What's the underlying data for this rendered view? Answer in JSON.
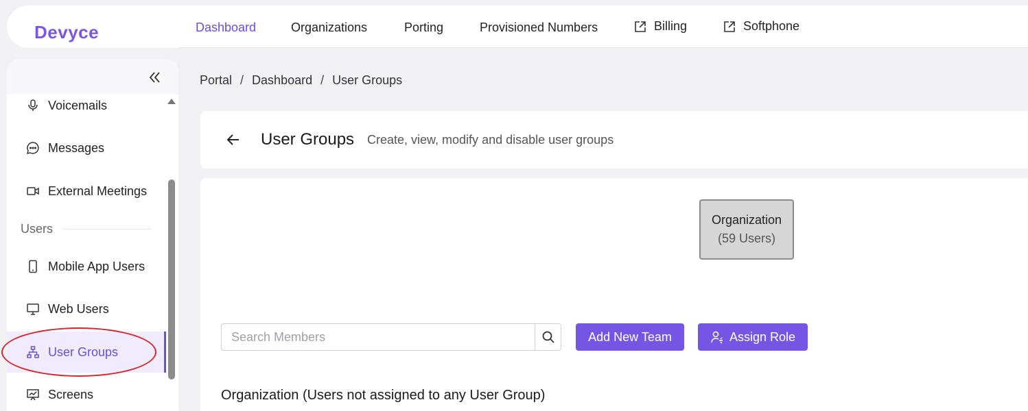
{
  "app": {
    "logo": "Devyce"
  },
  "topnav": {
    "items": [
      {
        "label": "Dashboard",
        "active": true
      },
      {
        "label": "Organizations"
      },
      {
        "label": "Porting"
      },
      {
        "label": "Provisioned Numbers"
      },
      {
        "label": "Billing",
        "icon": "external-link-icon"
      },
      {
        "label": "Softphone",
        "icon": "external-link-icon"
      }
    ]
  },
  "sidebar": {
    "items": [
      {
        "label": "Voicemails",
        "icon": "microphone-icon"
      },
      {
        "label": "Messages",
        "icon": "chat-bubble-icon"
      },
      {
        "label": "External Meetings",
        "icon": "video-camera-icon"
      },
      {
        "label": "Mobile App Users",
        "icon": "mobile-phone-icon"
      },
      {
        "label": "Web Users",
        "icon": "monitor-icon"
      },
      {
        "label": "User Groups",
        "icon": "hierarchy-icon",
        "active": true
      },
      {
        "label": "Screens",
        "icon": "presentation-icon"
      }
    ],
    "section_users": "Users"
  },
  "breadcrumb": {
    "items": [
      "Portal",
      "Dashboard",
      "User Groups"
    ],
    "separator": "/"
  },
  "header": {
    "title": "User Groups",
    "subtitle": "Create, view, modify and disable user groups"
  },
  "org_node": {
    "title": "Organization",
    "count": "(59 Users)"
  },
  "search": {
    "placeholder": "Search Members"
  },
  "buttons": {
    "add_team": "Add New Team",
    "assign_role": "Assign Role"
  },
  "section_title": "Organization (Users not assigned to any User Group)",
  "colors": {
    "accent": "#7556e4",
    "active_bg": "#f1ecfd",
    "highlight": "#d8232a"
  }
}
